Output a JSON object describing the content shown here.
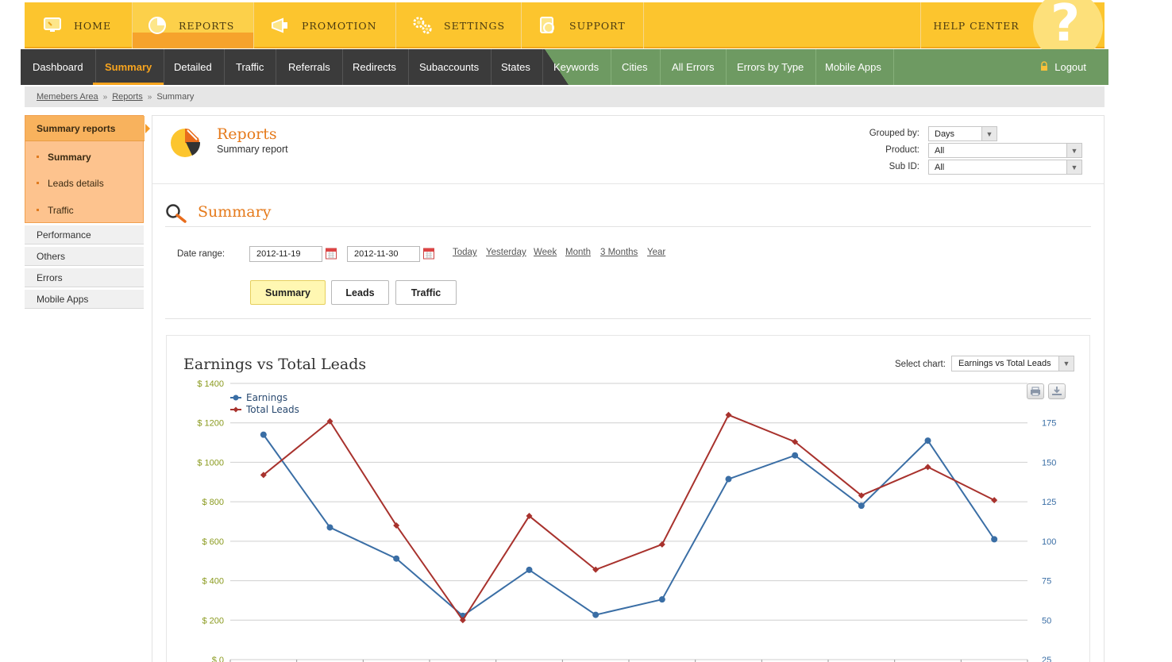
{
  "topnav": {
    "items": [
      {
        "label": "HOME",
        "icon": "monitor-icon"
      },
      {
        "label": "REPORTS",
        "icon": "pie-chart-icon"
      },
      {
        "label": "PROMOTION",
        "icon": "megaphone-icon"
      },
      {
        "label": "SETTINGS",
        "icon": "gears-icon"
      },
      {
        "label": "SUPPORT",
        "icon": "support-icon"
      }
    ],
    "help_label": "HELP CENTER",
    "help_glyph": "?"
  },
  "subnav": {
    "items": [
      "Dashboard",
      "Summary",
      "Detailed",
      "Traffic",
      "Referrals",
      "Redirects",
      "Subaccounts",
      "States",
      "Keywords",
      "Cities",
      "All Errors",
      "Errors by Type",
      "Mobile Apps"
    ],
    "logout": "Logout"
  },
  "breadcrumb": {
    "items": [
      "Memebers Area",
      "Reports",
      "Summary"
    ]
  },
  "sidebar": {
    "section_title": "Summary reports",
    "section_items": [
      "Summary",
      "Leads details",
      "Traffic"
    ],
    "items": [
      "Performance",
      "Others",
      "Errors",
      "Mobile Apps"
    ]
  },
  "header": {
    "title": "Reports",
    "subtitle": "Summary report",
    "filters": {
      "grouped_by_label": "Grouped by:",
      "grouped_by_value": "Days",
      "product_label": "Product:",
      "product_value": "All",
      "subid_label": "Sub ID:",
      "subid_value": "All"
    }
  },
  "summary": {
    "title": "Summary",
    "date_range_label": "Date range:",
    "date_from": "2012-11-19",
    "date_to": "2012-11-30",
    "quick_links": [
      "Today",
      "Yesterday",
      "Week",
      "Month",
      "3 Months",
      "Year"
    ],
    "tabs": [
      "Summary",
      "Leads",
      "Traffic"
    ]
  },
  "chart_panel": {
    "select_label": "Select chart:",
    "select_value": "Earnings vs Total Leads"
  },
  "colors": {
    "earnings": "#3a6ea5",
    "leads": "#a8322d",
    "accent": "#e57a1b",
    "left_axis": "#8a9a1e"
  },
  "chart_data": {
    "type": "line",
    "title": "Earnings vs Total Leads",
    "x": [
      "",
      "",
      "",
      "",
      "",
      "",
      "",
      "",
      "",
      "",
      "",
      ""
    ],
    "series": [
      {
        "name": "Earnings",
        "axis": "left",
        "values": [
          1140,
          670,
          512,
          222,
          455,
          227,
          305,
          915,
          1035,
          780,
          1110,
          610
        ]
      },
      {
        "name": "Total Leads",
        "axis": "right",
        "values": [
          142,
          176,
          110,
          50,
          116,
          82,
          98,
          180,
          163,
          129,
          147,
          126
        ]
      }
    ],
    "y_left": {
      "ticks": [
        "$ 0",
        "$ 200",
        "$ 400",
        "$ 600",
        "$ 800",
        "$ 1000",
        "$ 1200",
        "$ 1400"
      ],
      "range": [
        0,
        1400
      ]
    },
    "y_right": {
      "ticks": [
        "25",
        "50",
        "75",
        "100",
        "125",
        "150",
        "175"
      ],
      "range": [
        25,
        200
      ]
    },
    "legend": "top-left",
    "grid": true
  }
}
